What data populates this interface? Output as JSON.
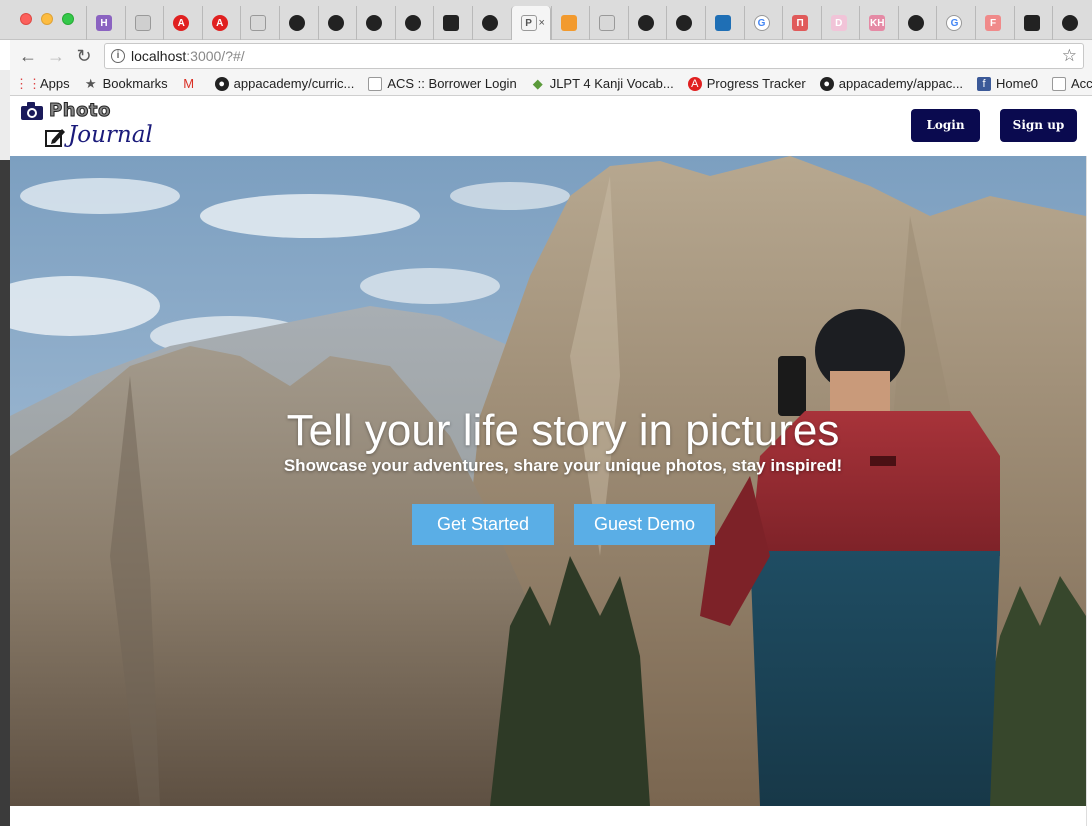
{
  "browser": {
    "tabs": [
      {
        "label": "H",
        "color": "#8b63c1",
        "icon": "h-icon"
      },
      {
        "label": "",
        "color": "#cfcfcf",
        "icon": "document-icon"
      },
      {
        "label": "A",
        "color": "#e02020",
        "icon": "a-icon"
      },
      {
        "label": "A",
        "color": "#e02020",
        "icon": "a-icon"
      },
      {
        "label": "",
        "color": "#d8d8d8",
        "icon": "document-icon"
      },
      {
        "label": "",
        "color": "#222222",
        "icon": "github-icon"
      },
      {
        "label": "",
        "color": "#222222",
        "icon": "github-icon"
      },
      {
        "label": "",
        "color": "#222222",
        "icon": "github-icon"
      },
      {
        "label": "",
        "color": "#222222",
        "icon": "github-icon"
      },
      {
        "label": "",
        "color": "#222222",
        "icon": "camera-icon"
      },
      {
        "label": "",
        "color": "#222222",
        "icon": "github-icon"
      },
      {
        "label": "P",
        "color": "#f5f5f5",
        "icon": "document-icon",
        "active": true
      },
      {
        "label": "",
        "color": "#f29a2e",
        "icon": "asterisk-icon"
      },
      {
        "label": "",
        "color": "#d8d8d8",
        "icon": "document-icon"
      },
      {
        "label": "",
        "color": "#222222",
        "icon": "github-icon"
      },
      {
        "label": "",
        "color": "#222222",
        "icon": "github-icon"
      },
      {
        "label": "",
        "color": "#1f6fb5",
        "icon": "house-icon"
      },
      {
        "label": "G",
        "color": "#ffffff",
        "icon": "google-icon"
      },
      {
        "label": "Π",
        "color": "#e05a5a",
        "icon": "pi-icon"
      },
      {
        "label": "D",
        "color": "#f1c4d8",
        "icon": "d-icon"
      },
      {
        "label": "KH",
        "color": "#e58aa5",
        "icon": "kh-icon"
      },
      {
        "label": "",
        "color": "#222222",
        "icon": "github-icon"
      },
      {
        "label": "G",
        "color": "#ffffff",
        "icon": "google-icon"
      },
      {
        "label": "F",
        "color": "#f08a8a",
        "icon": "f-icon"
      },
      {
        "label": "",
        "color": "#222222",
        "icon": "camera-icon"
      },
      {
        "label": "",
        "color": "#222222",
        "icon": "github-icon"
      }
    ],
    "active_tab_close": "×",
    "url_host": "localhost",
    "url_path": ":3000/?#/",
    "bookmarks": [
      {
        "label": "Apps",
        "icon": "apps-grid-icon"
      },
      {
        "label": "Bookmarks",
        "icon": "star-icon"
      },
      {
        "label": "",
        "icon": "gmail-icon"
      },
      {
        "label": "appacademy/curric...",
        "icon": "github-icon"
      },
      {
        "label": "ACS :: Borrower Login",
        "icon": "blank-icon"
      },
      {
        "label": "JLPT 4 Kanji Vocab...",
        "icon": "leaf-icon"
      },
      {
        "label": "Progress Tracker",
        "icon": "a-icon"
      },
      {
        "label": "appacademy/appac...",
        "icon": "github-icon"
      },
      {
        "label": "Home0",
        "icon": "facebook-icon"
      },
      {
        "label": "Accour",
        "icon": "document-icon"
      }
    ]
  },
  "app": {
    "logo_top": "Photo",
    "logo_bottom": "Journal",
    "login_label": "Login",
    "signup_label": "Sign up"
  },
  "hero": {
    "title": "Tell your life story in pictures",
    "subtitle": "Showcase your adventures, share your unique photos, stay inspired!",
    "get_started_label": "Get Started",
    "guest_demo_label": "Guest Demo"
  },
  "colors": {
    "brand_navy": "#0a0a4f",
    "cta_blue": "#5aaee6"
  }
}
